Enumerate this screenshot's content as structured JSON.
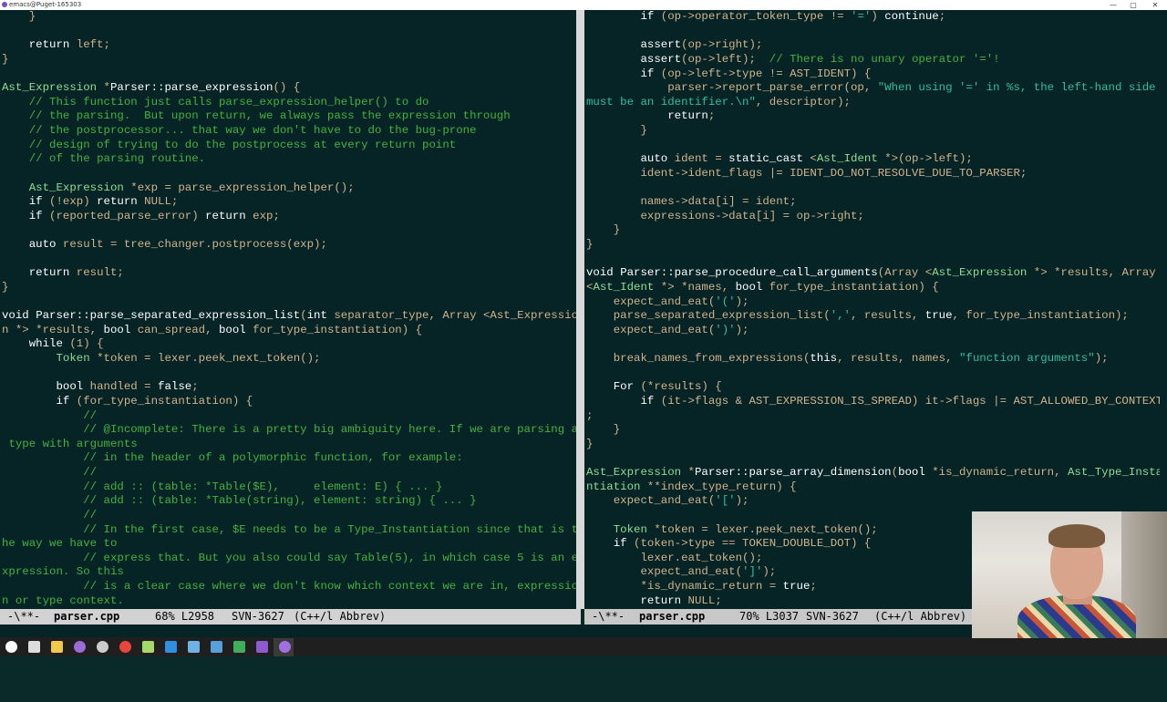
{
  "window": {
    "title": "emacs@Puget-165303",
    "minimize": "—",
    "maximize": "▢",
    "close": "✕"
  },
  "colors": {
    "background": "#062326",
    "text": "#d2b48c",
    "comment": "#44b340",
    "keyword": "#ffffff",
    "type": "#8cde94",
    "string": "#2ec09c",
    "modeline": "#d2d2d2"
  },
  "left_pane": {
    "lines": [
      [
        [
          "    }",
          "d"
        ]
      ],
      [
        [
          "",
          "d"
        ]
      ],
      [
        [
          "    ",
          "d"
        ],
        [
          "return",
          "kw"
        ],
        [
          " left;",
          "d"
        ]
      ],
      [
        [
          "}",
          "d"
        ]
      ],
      [
        [
          "",
          "d"
        ]
      ],
      [
        [
          "Ast_Expression",
          "ty"
        ],
        [
          " *",
          "d"
        ],
        [
          "Parser::parse_expression",
          "fn"
        ],
        [
          "() {",
          "d"
        ]
      ],
      [
        [
          "    ",
          "d"
        ],
        [
          "// This function just calls parse_expression_helper() to do",
          "cm"
        ]
      ],
      [
        [
          "    ",
          "d"
        ],
        [
          "// the parsing.  But upon return, we always pass the expression through",
          "cm"
        ]
      ],
      [
        [
          "    ",
          "d"
        ],
        [
          "// the postprocessor... that way we don't have to do the bug-prone",
          "cm"
        ]
      ],
      [
        [
          "    ",
          "d"
        ],
        [
          "// design of trying to do the postprocess at every return point",
          "cm"
        ]
      ],
      [
        [
          "    ",
          "d"
        ],
        [
          "// of the parsing routine.",
          "cm"
        ]
      ],
      [
        [
          "",
          "d"
        ]
      ],
      [
        [
          "    ",
          "d"
        ],
        [
          "Ast_Expression",
          "ty"
        ],
        [
          " *exp = parse_expression_helper();",
          "d"
        ]
      ],
      [
        [
          "    ",
          "d"
        ],
        [
          "if",
          "kw"
        ],
        [
          " (!exp) ",
          "d"
        ],
        [
          "return",
          "kw"
        ],
        [
          " NULL;",
          "d"
        ]
      ],
      [
        [
          "    ",
          "d"
        ],
        [
          "if",
          "kw"
        ],
        [
          " (reported_parse_error) ",
          "d"
        ],
        [
          "return",
          "kw"
        ],
        [
          " exp;",
          "d"
        ]
      ],
      [
        [
          "",
          "d"
        ]
      ],
      [
        [
          "    ",
          "d"
        ],
        [
          "auto",
          "kw"
        ],
        [
          " result = tree_changer.postprocess(exp);",
          "d"
        ]
      ],
      [
        [
          "",
          "d"
        ]
      ],
      [
        [
          "    ",
          "d"
        ],
        [
          "return",
          "kw"
        ],
        [
          " result;",
          "d"
        ]
      ],
      [
        [
          "}",
          "d"
        ]
      ],
      [
        [
          "",
          "d"
        ]
      ],
      [
        [
          "void",
          "kw"
        ],
        [
          " ",
          "d"
        ],
        [
          "Parser::parse_separated_expression_list",
          "fn"
        ],
        [
          "(",
          "d"
        ],
        [
          "int",
          "kw"
        ],
        [
          " separator_type, Array <Ast_Expressio",
          "d"
        ]
      ],
      [
        [
          "n *> *results, ",
          "d"
        ],
        [
          "bool",
          "kw"
        ],
        [
          " can_spread, ",
          "d"
        ],
        [
          "bool",
          "kw"
        ],
        [
          " for_type_instantiation) {",
          "d"
        ]
      ],
      [
        [
          "    ",
          "d"
        ],
        [
          "while",
          "kw"
        ],
        [
          " (1) {",
          "d"
        ]
      ],
      [
        [
          "        ",
          "d"
        ],
        [
          "Token",
          "ty"
        ],
        [
          " *token = lexer.peek_next_token();",
          "d"
        ]
      ],
      [
        [
          "",
          "d"
        ]
      ],
      [
        [
          "        ",
          "d"
        ],
        [
          "bool",
          "kw"
        ],
        [
          " handled = ",
          "d"
        ],
        [
          "false",
          "kw"
        ],
        [
          ";",
          "d"
        ]
      ],
      [
        [
          "        ",
          "d"
        ],
        [
          "if",
          "kw"
        ],
        [
          " (for_type_instantiation) {",
          "d"
        ]
      ],
      [
        [
          "            ",
          "d"
        ],
        [
          "//",
          "cm"
        ]
      ],
      [
        [
          "            ",
          "d"
        ],
        [
          "// @Incomplete: There is a pretty big ambiguity here. If we are parsing a",
          "cm"
        ]
      ],
      [
        [
          " ",
          "d"
        ],
        [
          "type with arguments",
          "cm"
        ]
      ],
      [
        [
          "            ",
          "d"
        ],
        [
          "// in the header of a polymorphic function, for example:",
          "cm"
        ]
      ],
      [
        [
          "            ",
          "d"
        ],
        [
          "//",
          "cm"
        ]
      ],
      [
        [
          "            ",
          "d"
        ],
        [
          "// add :: (table: *Table($E),     element: E) { ... }",
          "cm"
        ]
      ],
      [
        [
          "            ",
          "d"
        ],
        [
          "// add :: (table: *Table(string), element: string) { ... }",
          "cm"
        ]
      ],
      [
        [
          "            ",
          "d"
        ],
        [
          "//",
          "cm"
        ]
      ],
      [
        [
          "            ",
          "d"
        ],
        [
          "// In the first case, $E needs to be a Type_Instantiation since that is t",
          "cm"
        ]
      ],
      [
        [
          "he way we have to",
          "cm"
        ]
      ],
      [
        [
          "            ",
          "d"
        ],
        [
          "// express that. But you also could say Table(5), in which case 5 is an e",
          "cm"
        ]
      ],
      [
        [
          "xpression. So this",
          "cm"
        ]
      ],
      [
        [
          "            ",
          "d"
        ],
        [
          "// is a clear case where we don't know which context we are in, expressio",
          "cm"
        ]
      ],
      [
        [
          "n or type context.",
          "cm"
        ]
      ]
    ]
  },
  "right_pane": {
    "lines": [
      [
        [
          "        ",
          "d"
        ],
        [
          "if",
          "kw"
        ],
        [
          " (op->operator_token_type != ",
          "d"
        ],
        [
          "'='",
          "st"
        ],
        [
          ") ",
          "d"
        ],
        [
          "continue",
          "kw"
        ],
        [
          ";",
          "d"
        ]
      ],
      [
        [
          "",
          "d"
        ]
      ],
      [
        [
          "        ",
          "d"
        ],
        [
          "assert",
          "fn"
        ],
        [
          "(op->right);",
          "d"
        ]
      ],
      [
        [
          "        ",
          "d"
        ],
        [
          "assert",
          "fn"
        ],
        [
          "(op->left);  ",
          "d"
        ],
        [
          "// There is no unary operator '='!",
          "cm"
        ]
      ],
      [
        [
          "        ",
          "d"
        ],
        [
          "if",
          "kw"
        ],
        [
          " (op->left->type != AST_IDENT) {",
          "d"
        ]
      ],
      [
        [
          "            parser->report_parse_error(op, ",
          "d"
        ],
        [
          "\"When using '=' in %s, the left-hand side",
          "st"
        ]
      ],
      [
        [
          "must be an identifier.\\n\"",
          "st"
        ],
        [
          ", descriptor);",
          "d"
        ]
      ],
      [
        [
          "            ",
          "d"
        ],
        [
          "return",
          "kw"
        ],
        [
          ";",
          "d"
        ]
      ],
      [
        [
          "        }",
          "d"
        ]
      ],
      [
        [
          "",
          "d"
        ]
      ],
      [
        [
          "        ",
          "d"
        ],
        [
          "auto",
          "kw"
        ],
        [
          " ident = ",
          "d"
        ],
        [
          "static_cast",
          "kw"
        ],
        [
          " <",
          "d"
        ],
        [
          "Ast_Ident",
          "ty"
        ],
        [
          " *>(op->left);",
          "d"
        ]
      ],
      [
        [
          "        ident->ident_flags |= IDENT_DO_NOT_RESOLVE_DUE_TO_PARSER;",
          "d"
        ]
      ],
      [
        [
          "",
          "d"
        ]
      ],
      [
        [
          "        names->data[i] = ident;",
          "d"
        ]
      ],
      [
        [
          "        expressions->data[i] = op->right;",
          "d"
        ]
      ],
      [
        [
          "    }",
          "d"
        ]
      ],
      [
        [
          "}",
          "d"
        ]
      ],
      [
        [
          "",
          "d"
        ]
      ],
      [
        [
          "void",
          "kw"
        ],
        [
          " ",
          "d"
        ],
        [
          "Parser::parse_procedure_call_arguments",
          "fn"
        ],
        [
          "(Array <",
          "d"
        ],
        [
          "Ast_Expression",
          "ty"
        ],
        [
          " *> *results, Array",
          "d"
        ]
      ],
      [
        [
          "<",
          "d"
        ],
        [
          "Ast_Ident",
          "ty"
        ],
        [
          " *> *names, ",
          "d"
        ],
        [
          "bool",
          "kw"
        ],
        [
          " for_type_instantiation) {",
          "d"
        ]
      ],
      [
        [
          "    expect_and_eat(",
          "d"
        ],
        [
          "'('",
          "st"
        ],
        [
          ");",
          "d"
        ]
      ],
      [
        [
          "    parse_separated_expression_list(",
          "d"
        ],
        [
          "','",
          "st"
        ],
        [
          ", results, ",
          "d"
        ],
        [
          "true",
          "kw"
        ],
        [
          ", for_type_instantiation);",
          "d"
        ]
      ],
      [
        [
          "    expect_and_eat(",
          "d"
        ],
        [
          "')'",
          "st"
        ],
        [
          ");",
          "d"
        ]
      ],
      [
        [
          "",
          "d"
        ]
      ],
      [
        [
          "    break_names_from_expressions(",
          "d"
        ],
        [
          "this",
          "kw"
        ],
        [
          ", results, names, ",
          "d"
        ],
        [
          "\"function arguments\"",
          "st"
        ],
        [
          ");",
          "d"
        ]
      ],
      [
        [
          "",
          "d"
        ]
      ],
      [
        [
          "    ",
          "d"
        ],
        [
          "For",
          "kw"
        ],
        [
          " (*results) {",
          "d"
        ]
      ],
      [
        [
          "        ",
          "d"
        ],
        [
          "if",
          "kw"
        ],
        [
          " (it->flags & AST_EXPRESSION_IS_SPREAD) it->flags |= AST_ALLOWED_BY_CONTEXT",
          "d"
        ]
      ],
      [
        [
          ";",
          "d"
        ]
      ],
      [
        [
          "    }",
          "d"
        ]
      ],
      [
        [
          "}",
          "d"
        ]
      ],
      [
        [
          "",
          "d"
        ]
      ],
      [
        [
          "Ast_Expression",
          "ty"
        ],
        [
          " *",
          "d"
        ],
        [
          "Parser::parse_array_dimension",
          "fn"
        ],
        [
          "(",
          "d"
        ],
        [
          "bool",
          "kw"
        ],
        [
          " *is_dynamic_return, ",
          "d"
        ],
        [
          "Ast_Type_Insta",
          "ty"
        ]
      ],
      [
        [
          "ntiation",
          "ty"
        ],
        [
          " **index_type_return) {",
          "d"
        ]
      ],
      [
        [
          "    expect_and_eat(",
          "d"
        ],
        [
          "'['",
          "st"
        ],
        [
          ");",
          "d"
        ]
      ],
      [
        [
          "",
          "d"
        ]
      ],
      [
        [
          "    ",
          "d"
        ],
        [
          "Token",
          "ty"
        ],
        [
          " *token = lexer.peek_next_token();",
          "d"
        ]
      ],
      [
        [
          "    ",
          "d"
        ],
        [
          "if",
          "kw"
        ],
        [
          " (token->type == TOKEN_DOUBLE_DOT) {",
          "d"
        ]
      ],
      [
        [
          "        lexer.eat_token();",
          "d"
        ]
      ],
      [
        [
          "        expect_and_eat(",
          "d"
        ],
        [
          "']'",
          "st"
        ],
        [
          ");",
          "d"
        ]
      ],
      [
        [
          "        *is_dynamic_return = ",
          "d"
        ],
        [
          "true",
          "kw"
        ],
        [
          ";",
          "d"
        ]
      ],
      [
        [
          "        ",
          "d"
        ],
        [
          "return",
          "kw"
        ],
        [
          " NULL;",
          "d"
        ]
      ]
    ]
  },
  "modeline_left": {
    "status": "-\\**-",
    "buffer": "parser.cpp",
    "position": "68% L2958",
    "vc": "SVN-3627",
    "mode": "(C++/l Abbrev)"
  },
  "modeline_right": {
    "status": "-\\**-",
    "buffer": "parser.cpp",
    "position": "70% L3037",
    "vc": "SVN-3627",
    "mode": "(C++/l Abbrev)"
  },
  "taskbar": {
    "icons": [
      {
        "name": "start-icon",
        "color": "#ffffff"
      },
      {
        "name": "task-view-icon",
        "color": "#dddddd"
      },
      {
        "name": "file-explorer-icon",
        "color": "#f2c94c"
      },
      {
        "name": "emacs-icon",
        "color": "#9b6bd6"
      },
      {
        "name": "settings-icon",
        "color": "#cccccc"
      },
      {
        "name": "chrome-icon",
        "color": "#e8453c"
      },
      {
        "name": "notepad-icon",
        "color": "#a6d86a"
      },
      {
        "name": "ie-icon",
        "color": "#2f8fe0"
      },
      {
        "name": "tools-icon",
        "color": "#6fb3e6"
      },
      {
        "name": "terminal-icon",
        "color": "#5aa0d8"
      },
      {
        "name": "green-app-icon",
        "color": "#3fae5a"
      },
      {
        "name": "visual-studio-icon",
        "color": "#8c5bd0"
      },
      {
        "name": "emacs-active-icon",
        "color": "#a070e0"
      }
    ]
  }
}
